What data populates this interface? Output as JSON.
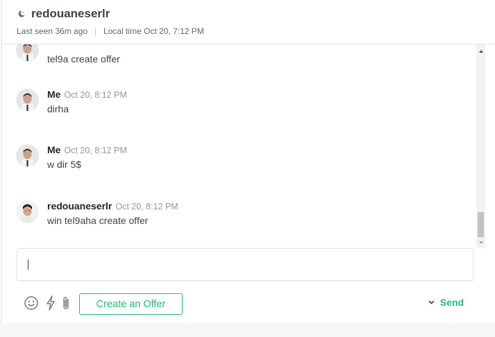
{
  "header": {
    "username": "redouaneserlr",
    "last_seen": "Last seen 36m ago",
    "local_time": "Local time Oct 20, 7:12 PM"
  },
  "messages": [
    {
      "sender": "",
      "time": "",
      "text": "tel9a create offer",
      "avatar": "me"
    },
    {
      "sender": "Me",
      "time": "Oct 20, 8:12 PM",
      "text": "dirha",
      "avatar": "me"
    },
    {
      "sender": "Me",
      "time": "Oct 20, 8:12 PM",
      "text": "w dir 5$",
      "avatar": "me"
    },
    {
      "sender": "redouaneserlr",
      "time": "Oct 20, 8:12 PM",
      "text": "win tel9aha create offer",
      "avatar": "other"
    }
  ],
  "composer": {
    "value": "",
    "placeholder": ""
  },
  "toolbar": {
    "create_offer_label": "Create an Offer",
    "send_label": "Send"
  },
  "colors": {
    "accent_green": "#1dbf73",
    "text_primary": "#404145",
    "text_muted": "#95979d",
    "border": "#e4e5e7"
  },
  "icons": {
    "status": "moon-icon",
    "emoji": "smiley-icon",
    "quick": "lightning-icon",
    "attach": "paperclip-icon",
    "send_options": "chevron-down-icon"
  }
}
